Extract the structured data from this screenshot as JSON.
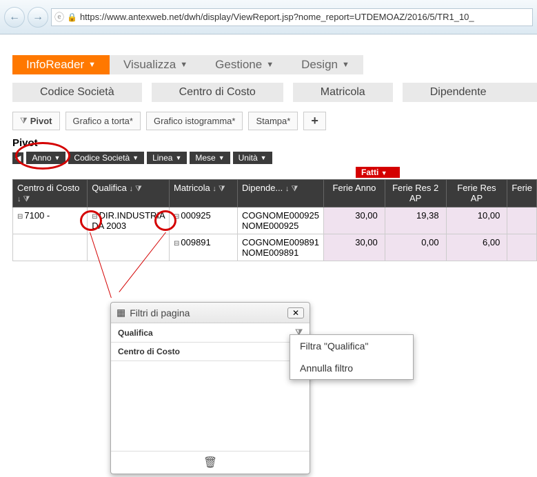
{
  "browser": {
    "url": "https://www.antexweb.net/dwh/display/ViewReport.jsp?nome_report=UTDEMOAZ/2016/5/TR1_10_"
  },
  "menu": {
    "inforeader": "InfoReader",
    "visualizza": "Visualizza",
    "gestione": "Gestione",
    "design": "Design"
  },
  "breadcrumb": {
    "a": "Codice Società",
    "b": "Centro di Costo",
    "c": "Matricola",
    "d": "Dipendente"
  },
  "toolbar": {
    "pivot": "Pivot",
    "torta": "Grafico a torta*",
    "isto": "Grafico istogramma*",
    "stampa": "Stampa*",
    "plus": "+"
  },
  "pivot_title": "Pivot",
  "dims": {
    "anno": "Anno",
    "codice": "Codice Società",
    "linea": "Linea",
    "mese": "Mese",
    "unita": "Unità"
  },
  "fatti": "Fatti",
  "headers": {
    "centro": "Centro di Costo",
    "qualifica": "Qualifica",
    "matricola": "Matricola",
    "dipende": "Dipende...",
    "ferie_anno": "Ferie Anno",
    "ferie_res2": "Ferie Res 2 AP",
    "ferie_resap": "Ferie Res AP",
    "ferie_last": "Ferie"
  },
  "rows": [
    {
      "centro": "7100 -",
      "qualifica": "DIR.INDUSTRIA DA 2003",
      "matricola": "000925",
      "dipende": "COGNOME000925 NOME000925",
      "v1": "30,00",
      "v2": "19,38",
      "v3": "10,00"
    },
    {
      "centro": "",
      "qualifica": "",
      "matricola": "009891",
      "dipende": "COGNOME009891 NOME009891",
      "v1": "30,00",
      "v2": "0,00",
      "v3": "6,00"
    }
  ],
  "dialog": {
    "title": "Filtri di pagina",
    "row1": "Qualifica",
    "row2": "Centro di Costo"
  },
  "ctx": {
    "filtra": "Filtra \"Qualifica\"",
    "annulla": "Annulla filtro"
  }
}
